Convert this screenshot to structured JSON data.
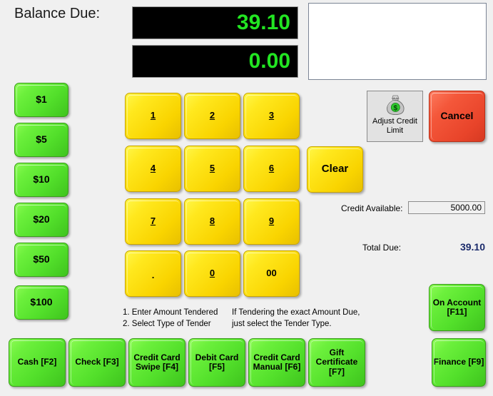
{
  "screen": {
    "background_color": "#f0f0f0",
    "balance_label": "Balance Due:",
    "lcd_balance": "39.10",
    "lcd_tendered": "0.00",
    "lcd_text_color": "#22e522",
    "lcd_background_color": "#000000"
  },
  "denominations": [
    {
      "label": "$1"
    },
    {
      "label": "$5"
    },
    {
      "label": "$10"
    },
    {
      "label": "$20"
    },
    {
      "label": "$50"
    },
    {
      "label": "$100"
    }
  ],
  "keypad": [
    {
      "label": "1",
      "underline": true
    },
    {
      "label": "2",
      "underline": true
    },
    {
      "label": "3",
      "underline": true
    },
    {
      "label": "4",
      "underline": true
    },
    {
      "label": "5",
      "underline": true
    },
    {
      "label": "6",
      "underline": true
    },
    {
      "label": "7",
      "underline": true
    },
    {
      "label": "8",
      "underline": true
    },
    {
      "label": "9",
      "underline": true
    },
    {
      "label": ".",
      "underline": false
    },
    {
      "label": "0",
      "underline": true
    },
    {
      "label": "00",
      "underline": false
    }
  ],
  "actions": {
    "clear_label": "Clear",
    "cancel_label": "Cancel",
    "adjust_credit_label": "Adjust Credit Limit",
    "adjust_credit_icon": "money-bag-icon",
    "on_account_label": "On Account [F11]",
    "finance_label": "Finance [F9]"
  },
  "credit": {
    "available_label": "Credit Available:",
    "available_value": "5000.00",
    "total_due_label": "Total Due:",
    "total_due_value": "39.10",
    "total_due_color": "#1a2a6b"
  },
  "instructions": {
    "left_line1": "1. Enter Amount Tendered",
    "left_line2": "2. Select Type of Tender",
    "right_line1": "If Tendering the exact Amount Due,",
    "right_line2": "just select the Tender Type."
  },
  "tenders": [
    {
      "label": "Cash [F2]"
    },
    {
      "label": "Check [F3]"
    },
    {
      "label": "Credit Card Swipe  [F4]"
    },
    {
      "label": "Debit Card [F5]"
    },
    {
      "label": "Credit Card Manual [F6]"
    },
    {
      "label": "Gift Certificate [F7]"
    }
  ],
  "colors": {
    "green_button": "#6cf03c",
    "yellow_button": "#ffe81e",
    "red_button": "#f4573a",
    "panel_gray": "#e2e2e2"
  }
}
